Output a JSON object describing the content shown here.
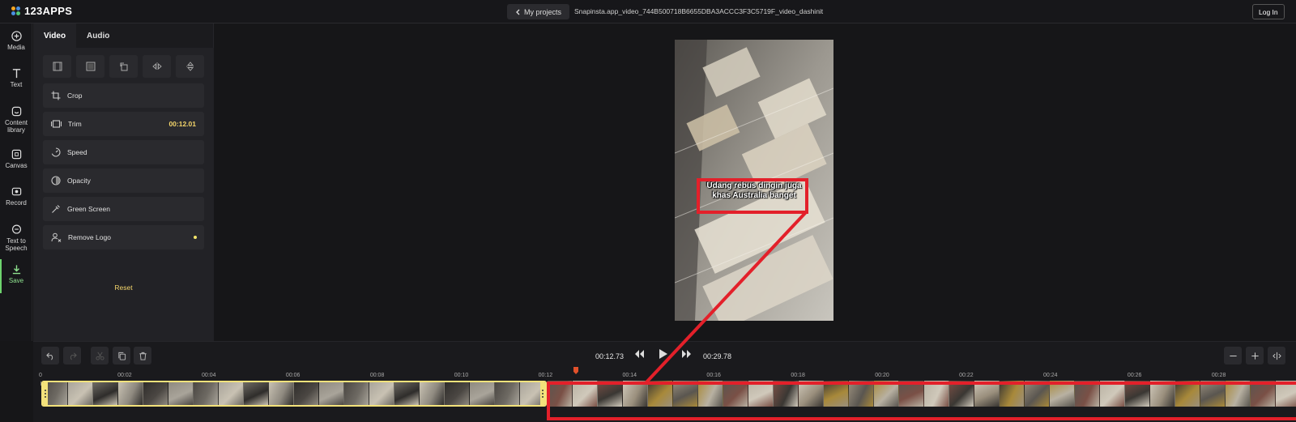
{
  "brand": {
    "name": "123APPS"
  },
  "header": {
    "projects_label": "My projects",
    "filename": "Snapinsta.app_video_744B500718B6655DBA3ACCC3F3C5719F_video_dashinit",
    "login_label": "Log In"
  },
  "rail": {
    "media": "Media",
    "text": "Text",
    "content_1": "Content",
    "content_2": "library",
    "canvas": "Canvas",
    "record": "Record",
    "tts_1": "Text to",
    "tts_2": "Speech",
    "save": "Save"
  },
  "panel": {
    "tab_video": "Video",
    "tab_audio": "Audio",
    "crop": "Crop",
    "trim": "Trim",
    "trim_value": "00:12.01",
    "speed": "Speed",
    "opacity": "Opacity",
    "green_screen": "Green Screen",
    "remove_logo": "Remove Logo",
    "reset": "Reset"
  },
  "preview": {
    "caption_line1": "Udang rebus dingin juga",
    "caption_line2": "khas Australia banget"
  },
  "timeline": {
    "current_time": "00:12.73",
    "total_time": "00:29.78",
    "ticks": [
      "0",
      "00:02",
      "00:04",
      "00:06",
      "00:08",
      "00:10",
      "00:12",
      "00:14",
      "00:16",
      "00:18",
      "00:20",
      "00:22",
      "00:24",
      "00:26",
      "00:28"
    ]
  },
  "colors": {
    "accent_yellow": "#f3e27b",
    "save_green": "#8fe38f",
    "annotation_red": "#e3202a",
    "playhead": "#e2512b"
  }
}
